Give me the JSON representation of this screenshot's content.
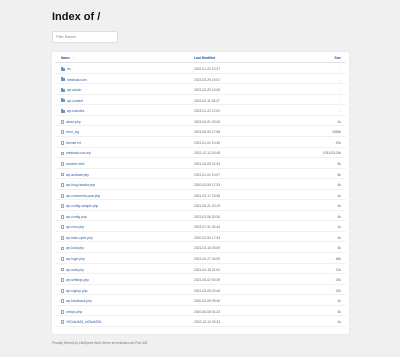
{
  "page": {
    "title": "Index of /",
    "filter_placeholder": "Filter Names",
    "footer": "Proudly Served by LiteSpeed Web Server at mekhala.com Port 443"
  },
  "table": {
    "headers": {
      "name": "Name",
      "modified": "Last Modified",
      "size": "Size",
      "sort_arrow": "↑"
    },
    "rows": [
      {
        "name": "hs",
        "modified": "2022-01-22 10:37",
        "size": "-",
        "type": "folder"
      },
      {
        "name": "mekhala.com",
        "modified": "2023-03-29 15:01",
        "size": "-",
        "type": "folder"
      },
      {
        "name": "wp-admin",
        "modified": "2023-03-29 13:05",
        "size": "-",
        "type": "folder"
      },
      {
        "name": "wp-content",
        "modified": "2023-02-11 05:37",
        "size": "-",
        "type": "folder"
      },
      {
        "name": "wp-includes",
        "modified": "2023-01-22 12:02",
        "size": "-",
        "type": "folder"
      },
      {
        "name": "about.php",
        "modified": "2023-04-21 03:26",
        "size": "4k",
        "type": "file"
      },
      {
        "name": "error_log",
        "modified": "2023-06-05 17:58",
        "size": "4056k",
        "type": "file"
      },
      {
        "name": "license.txt",
        "modified": "2021-01-01 10:40",
        "size": "20k",
        "type": "file"
      },
      {
        "name": "mekhala.com.zip",
        "modified": "2022-12-12 00:48",
        "size": "105142124k",
        "type": "file"
      },
      {
        "name": "readme.html",
        "modified": "2021-03-05 21:43",
        "size": "8k",
        "type": "file"
      },
      {
        "name": "wp-activate.php",
        "modified": "2021-01-01 10:07",
        "size": "8k",
        "type": "file"
      },
      {
        "name": "wp-blog-header.php",
        "modified": "2020-02-06 17:33",
        "size": "4k",
        "type": "file"
      },
      {
        "name": "wp-comments-post.php",
        "modified": "2021-03-17 23:38",
        "size": "4k",
        "type": "file"
      },
      {
        "name": "wp-config-sample.php",
        "modified": "2021-05-21 20:19",
        "size": "4k",
        "type": "file"
      },
      {
        "name": "wp-config.php",
        "modified": "2023-03-06 20:30",
        "size": "4k",
        "type": "file"
      },
      {
        "name": "wp-cron.php",
        "modified": "2023-07-31 04:44",
        "size": "4k",
        "type": "file"
      },
      {
        "name": "wp-links-opml.php",
        "modified": "2020-02-06 17:33",
        "size": "4k",
        "type": "file"
      },
      {
        "name": "wp-load.php",
        "modified": "2021-03-18 03:09",
        "size": "4k",
        "type": "file"
      },
      {
        "name": "wp-login.php",
        "modified": "2021-04-27 04:09",
        "size": "48k",
        "type": "file"
      },
      {
        "name": "wp-mail.php",
        "modified": "2021-04-15 21:02",
        "size": "12k",
        "type": "file"
      },
      {
        "name": "wp-settings.php",
        "modified": "2021-06-02 00:39",
        "size": "24k",
        "type": "file"
      },
      {
        "name": "wp-signup.php",
        "modified": "2021-03-05 02:46",
        "size": "32k",
        "type": "file"
      },
      {
        "name": "wp-trackback.php",
        "modified": "2020-03-05 09:40",
        "size": "4k",
        "type": "file"
      },
      {
        "name": "xmlrpc.php",
        "modified": "2020-06-08 01:23",
        "size": "4k",
        "type": "file"
      },
      {
        "name": "YKDdsJkJ8_vxDkeMSN",
        "modified": "2022-12-12 09:33",
        "size": "4k",
        "type": "file"
      }
    ]
  }
}
